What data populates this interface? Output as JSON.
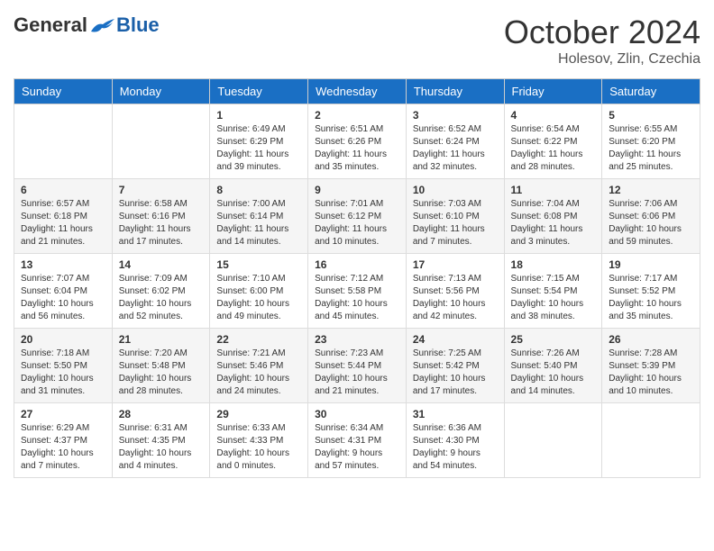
{
  "logo": {
    "general": "General",
    "blue": "Blue"
  },
  "header": {
    "month": "October 2024",
    "location": "Holesov, Zlin, Czechia"
  },
  "weekdays": [
    "Sunday",
    "Monday",
    "Tuesday",
    "Wednesday",
    "Thursday",
    "Friday",
    "Saturday"
  ],
  "weeks": [
    [
      {
        "day": "",
        "sunrise": "",
        "sunset": "",
        "daylight": ""
      },
      {
        "day": "",
        "sunrise": "",
        "sunset": "",
        "daylight": ""
      },
      {
        "day": "1",
        "sunrise": "Sunrise: 6:49 AM",
        "sunset": "Sunset: 6:29 PM",
        "daylight": "Daylight: 11 hours and 39 minutes."
      },
      {
        "day": "2",
        "sunrise": "Sunrise: 6:51 AM",
        "sunset": "Sunset: 6:26 PM",
        "daylight": "Daylight: 11 hours and 35 minutes."
      },
      {
        "day": "3",
        "sunrise": "Sunrise: 6:52 AM",
        "sunset": "Sunset: 6:24 PM",
        "daylight": "Daylight: 11 hours and 32 minutes."
      },
      {
        "day": "4",
        "sunrise": "Sunrise: 6:54 AM",
        "sunset": "Sunset: 6:22 PM",
        "daylight": "Daylight: 11 hours and 28 minutes."
      },
      {
        "day": "5",
        "sunrise": "Sunrise: 6:55 AM",
        "sunset": "Sunset: 6:20 PM",
        "daylight": "Daylight: 11 hours and 25 minutes."
      }
    ],
    [
      {
        "day": "6",
        "sunrise": "Sunrise: 6:57 AM",
        "sunset": "Sunset: 6:18 PM",
        "daylight": "Daylight: 11 hours and 21 minutes."
      },
      {
        "day": "7",
        "sunrise": "Sunrise: 6:58 AM",
        "sunset": "Sunset: 6:16 PM",
        "daylight": "Daylight: 11 hours and 17 minutes."
      },
      {
        "day": "8",
        "sunrise": "Sunrise: 7:00 AM",
        "sunset": "Sunset: 6:14 PM",
        "daylight": "Daylight: 11 hours and 14 minutes."
      },
      {
        "day": "9",
        "sunrise": "Sunrise: 7:01 AM",
        "sunset": "Sunset: 6:12 PM",
        "daylight": "Daylight: 11 hours and 10 minutes."
      },
      {
        "day": "10",
        "sunrise": "Sunrise: 7:03 AM",
        "sunset": "Sunset: 6:10 PM",
        "daylight": "Daylight: 11 hours and 7 minutes."
      },
      {
        "day": "11",
        "sunrise": "Sunrise: 7:04 AM",
        "sunset": "Sunset: 6:08 PM",
        "daylight": "Daylight: 11 hours and 3 minutes."
      },
      {
        "day": "12",
        "sunrise": "Sunrise: 7:06 AM",
        "sunset": "Sunset: 6:06 PM",
        "daylight": "Daylight: 10 hours and 59 minutes."
      }
    ],
    [
      {
        "day": "13",
        "sunrise": "Sunrise: 7:07 AM",
        "sunset": "Sunset: 6:04 PM",
        "daylight": "Daylight: 10 hours and 56 minutes."
      },
      {
        "day": "14",
        "sunrise": "Sunrise: 7:09 AM",
        "sunset": "Sunset: 6:02 PM",
        "daylight": "Daylight: 10 hours and 52 minutes."
      },
      {
        "day": "15",
        "sunrise": "Sunrise: 7:10 AM",
        "sunset": "Sunset: 6:00 PM",
        "daylight": "Daylight: 10 hours and 49 minutes."
      },
      {
        "day": "16",
        "sunrise": "Sunrise: 7:12 AM",
        "sunset": "Sunset: 5:58 PM",
        "daylight": "Daylight: 10 hours and 45 minutes."
      },
      {
        "day": "17",
        "sunrise": "Sunrise: 7:13 AM",
        "sunset": "Sunset: 5:56 PM",
        "daylight": "Daylight: 10 hours and 42 minutes."
      },
      {
        "day": "18",
        "sunrise": "Sunrise: 7:15 AM",
        "sunset": "Sunset: 5:54 PM",
        "daylight": "Daylight: 10 hours and 38 minutes."
      },
      {
        "day": "19",
        "sunrise": "Sunrise: 7:17 AM",
        "sunset": "Sunset: 5:52 PM",
        "daylight": "Daylight: 10 hours and 35 minutes."
      }
    ],
    [
      {
        "day": "20",
        "sunrise": "Sunrise: 7:18 AM",
        "sunset": "Sunset: 5:50 PM",
        "daylight": "Daylight: 10 hours and 31 minutes."
      },
      {
        "day": "21",
        "sunrise": "Sunrise: 7:20 AM",
        "sunset": "Sunset: 5:48 PM",
        "daylight": "Daylight: 10 hours and 28 minutes."
      },
      {
        "day": "22",
        "sunrise": "Sunrise: 7:21 AM",
        "sunset": "Sunset: 5:46 PM",
        "daylight": "Daylight: 10 hours and 24 minutes."
      },
      {
        "day": "23",
        "sunrise": "Sunrise: 7:23 AM",
        "sunset": "Sunset: 5:44 PM",
        "daylight": "Daylight: 10 hours and 21 minutes."
      },
      {
        "day": "24",
        "sunrise": "Sunrise: 7:25 AM",
        "sunset": "Sunset: 5:42 PM",
        "daylight": "Daylight: 10 hours and 17 minutes."
      },
      {
        "day": "25",
        "sunrise": "Sunrise: 7:26 AM",
        "sunset": "Sunset: 5:40 PM",
        "daylight": "Daylight: 10 hours and 14 minutes."
      },
      {
        "day": "26",
        "sunrise": "Sunrise: 7:28 AM",
        "sunset": "Sunset: 5:39 PM",
        "daylight": "Daylight: 10 hours and 10 minutes."
      }
    ],
    [
      {
        "day": "27",
        "sunrise": "Sunrise: 6:29 AM",
        "sunset": "Sunset: 4:37 PM",
        "daylight": "Daylight: 10 hours and 7 minutes."
      },
      {
        "day": "28",
        "sunrise": "Sunrise: 6:31 AM",
        "sunset": "Sunset: 4:35 PM",
        "daylight": "Daylight: 10 hours and 4 minutes."
      },
      {
        "day": "29",
        "sunrise": "Sunrise: 6:33 AM",
        "sunset": "Sunset: 4:33 PM",
        "daylight": "Daylight: 10 hours and 0 minutes."
      },
      {
        "day": "30",
        "sunrise": "Sunrise: 6:34 AM",
        "sunset": "Sunset: 4:31 PM",
        "daylight": "Daylight: 9 hours and 57 minutes."
      },
      {
        "day": "31",
        "sunrise": "Sunrise: 6:36 AM",
        "sunset": "Sunset: 4:30 PM",
        "daylight": "Daylight: 9 hours and 54 minutes."
      },
      {
        "day": "",
        "sunrise": "",
        "sunset": "",
        "daylight": ""
      },
      {
        "day": "",
        "sunrise": "",
        "sunset": "",
        "daylight": ""
      }
    ]
  ]
}
